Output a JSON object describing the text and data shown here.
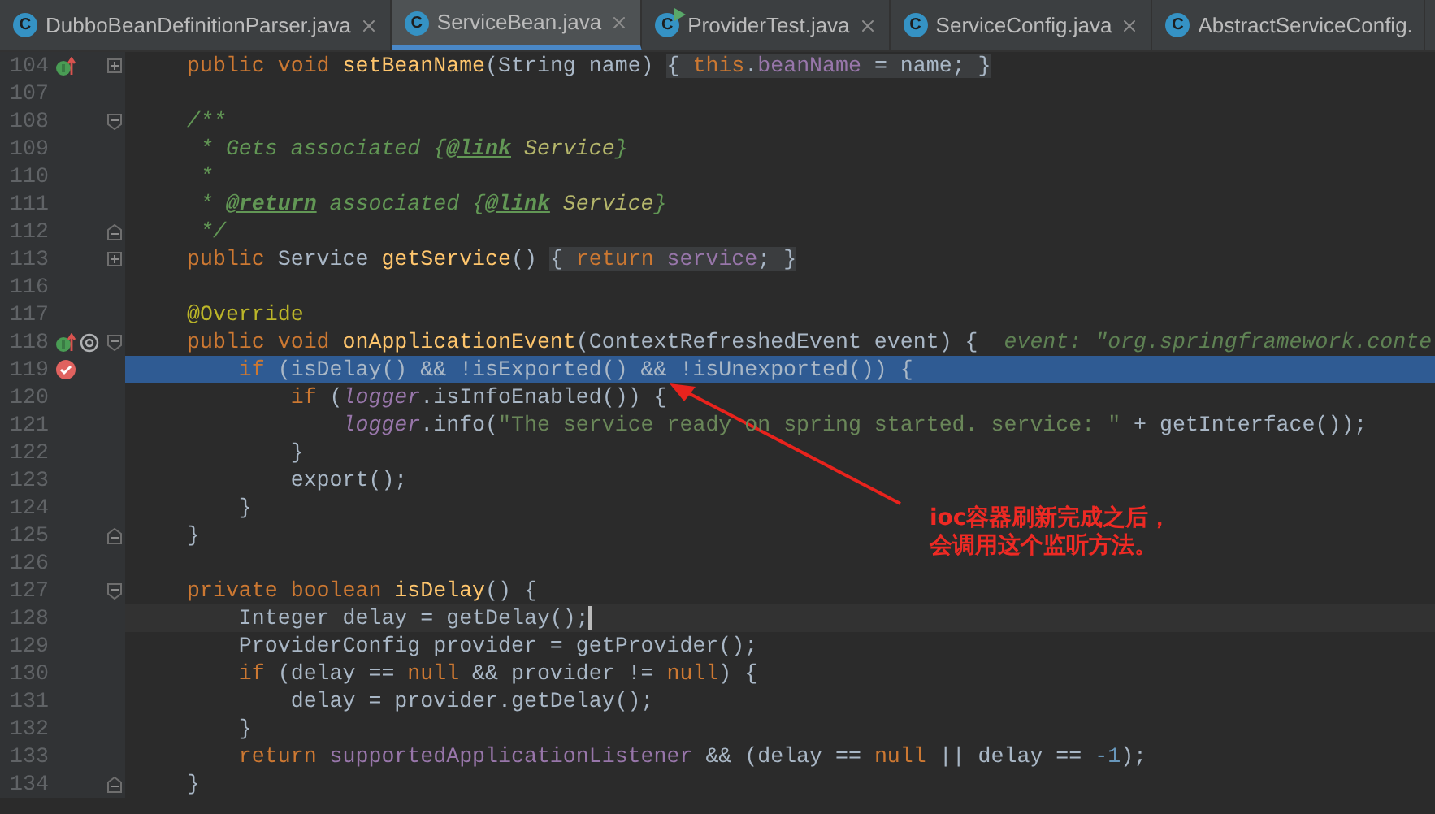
{
  "tabs": [
    {
      "label": "DubboBeanDefinitionParser.java",
      "icon_letter": "C",
      "runnable": false,
      "closable": true,
      "selected": false
    },
    {
      "label": "ServiceBean.java",
      "icon_letter": "C",
      "runnable": false,
      "closable": true,
      "selected": true
    },
    {
      "label": "ProviderTest.java",
      "icon_letter": "C",
      "runnable": true,
      "closable": true,
      "selected": false
    },
    {
      "label": "ServiceConfig.java",
      "icon_letter": "C",
      "runnable": false,
      "closable": true,
      "selected": false
    },
    {
      "label": "AbstractServiceConfig.",
      "icon_letter": "C",
      "runnable": false,
      "closable": false,
      "selected": false
    }
  ],
  "lines": [
    {
      "number": "104",
      "marks": [
        {
          "kind": "implements"
        }
      ],
      "fold_marker": {
        "kind": "expand"
      },
      "selected": false,
      "current": false,
      "tokens": [
        {
          "text": "public void ",
          "kind": "kw"
        },
        {
          "text": "setBeanName",
          "kind": "fn"
        },
        {
          "text": "(String name) ",
          "kind": "plain"
        },
        {
          "text": "{ ",
          "kind": "foldplain"
        },
        {
          "text": "this",
          "kind": "foldkw"
        },
        {
          "text": ".",
          "kind": "foldplain"
        },
        {
          "text": "beanName",
          "kind": "foldfield"
        },
        {
          "text": " = name; }",
          "kind": "foldplain"
        }
      ]
    },
    {
      "number": "107",
      "selected": false,
      "current": false
    },
    {
      "number": "108",
      "fold_marker": {
        "kind": "start"
      },
      "selected": false,
      "current": false,
      "tokens": [
        {
          "text": "/**",
          "kind": "doc"
        }
      ]
    },
    {
      "number": "109",
      "selected": false,
      "current": false,
      "tokens": [
        {
          "text": " * Gets associated {",
          "kind": "doc"
        },
        {
          "text": "@link",
          "kind": "doctag"
        },
        {
          "text": " Service",
          "kind": "docref"
        },
        {
          "text": "}",
          "kind": "doc"
        }
      ]
    },
    {
      "number": "110",
      "selected": false,
      "current": false,
      "tokens": [
        {
          "text": " *",
          "kind": "doc"
        }
      ]
    },
    {
      "number": "111",
      "selected": false,
      "current": false,
      "tokens": [
        {
          "text": " * ",
          "kind": "doc"
        },
        {
          "text": "@return",
          "kind": "doctag"
        },
        {
          "text": " associated {",
          "kind": "doc"
        },
        {
          "text": "@link",
          "kind": "doctag"
        },
        {
          "text": " Service",
          "kind": "docref"
        },
        {
          "text": "}",
          "kind": "doc"
        }
      ]
    },
    {
      "number": "112",
      "fold_marker": {
        "kind": "end"
      },
      "selected": false,
      "current": false,
      "tokens": [
        {
          "text": " */",
          "kind": "doc"
        }
      ]
    },
    {
      "number": "113",
      "fold_marker": {
        "kind": "expand"
      },
      "selected": false,
      "current": false,
      "tokens": [
        {
          "text": "public ",
          "kind": "kw"
        },
        {
          "text": "Service ",
          "kind": "plain"
        },
        {
          "text": "getService",
          "kind": "fn"
        },
        {
          "text": "() ",
          "kind": "plain"
        },
        {
          "text": "{ ",
          "kind": "foldplain"
        },
        {
          "text": "return ",
          "kind": "foldkw"
        },
        {
          "text": "service",
          "kind": "foldfield"
        },
        {
          "text": "; }",
          "kind": "foldplain"
        }
      ]
    },
    {
      "number": "116",
      "selected": false,
      "current": false
    },
    {
      "number": "117",
      "selected": false,
      "current": false,
      "tokens": [
        {
          "text": "@Override",
          "kind": "annotation"
        }
      ]
    },
    {
      "number": "118",
      "marks": [
        {
          "kind": "implements"
        },
        {
          "kind": "annotation"
        }
      ],
      "fold_marker": {
        "kind": "start"
      },
      "selected": false,
      "current": false,
      "tokens": [
        {
          "text": "public void ",
          "kind": "kw"
        },
        {
          "text": "onApplicationEvent",
          "kind": "fn"
        },
        {
          "text": "(ContextRefreshedEvent event) {  ",
          "kind": "plain"
        },
        {
          "text": "event: \"org.springframework.conte",
          "kind": "hint"
        }
      ]
    },
    {
      "number": "119",
      "marks": [
        {
          "kind": "breakpoint"
        }
      ],
      "selected": true,
      "current": false,
      "tokens": [
        {
          "text": "    if ",
          "kind": "kw"
        },
        {
          "text": "(isDelay() && !isExported() && !isUnexported()) {",
          "kind": "plain"
        }
      ]
    },
    {
      "number": "120",
      "selected": false,
      "current": false,
      "tokens": [
        {
          "text": "        if ",
          "kind": "kw"
        },
        {
          "text": "(",
          "kind": "plain"
        },
        {
          "text": "logger",
          "kind": "static"
        },
        {
          "text": ".isInfoEnabled()) {",
          "kind": "plain"
        }
      ]
    },
    {
      "number": "121",
      "selected": false,
      "current": false,
      "tokens": [
        {
          "text": "            logger",
          "kind": "static"
        },
        {
          "text": ".info(",
          "kind": "plain"
        },
        {
          "text": "\"The service ready on spring started. service: \"",
          "kind": "str"
        },
        {
          "text": " + getInterface());",
          "kind": "plain"
        }
      ]
    },
    {
      "number": "122",
      "selected": false,
      "current": false,
      "tokens": [
        {
          "text": "        }",
          "kind": "plain"
        }
      ]
    },
    {
      "number": "123",
      "selected": false,
      "current": false,
      "tokens": [
        {
          "text": "        export();",
          "kind": "plain"
        }
      ]
    },
    {
      "number": "124",
      "selected": false,
      "current": false,
      "tokens": [
        {
          "text": "    }",
          "kind": "plain"
        }
      ]
    },
    {
      "number": "125",
      "fold_marker": {
        "kind": "end"
      },
      "selected": false,
      "current": false,
      "tokens": [
        {
          "text": "}",
          "kind": "plain"
        }
      ]
    },
    {
      "number": "126",
      "selected": false,
      "current": false
    },
    {
      "number": "127",
      "fold_marker": {
        "kind": "start"
      },
      "selected": false,
      "current": false,
      "tokens": [
        {
          "text": "private boolean ",
          "kind": "kw"
        },
        {
          "text": "isDelay",
          "kind": "fn"
        },
        {
          "text": "() {",
          "kind": "plain"
        }
      ]
    },
    {
      "number": "128",
      "selected": false,
      "current": true,
      "tokens": [
        {
          "text": "    Integer delay = getDelay();",
          "kind": "plain"
        }
      ]
    },
    {
      "number": "129",
      "selected": false,
      "current": false,
      "tokens": [
        {
          "text": "    ProviderConfig provider = getProvider();",
          "kind": "plain"
        }
      ]
    },
    {
      "number": "130",
      "selected": false,
      "current": false,
      "tokens": [
        {
          "text": "    if ",
          "kind": "kw"
        },
        {
          "text": "(delay == ",
          "kind": "plain"
        },
        {
          "text": "null",
          "kind": "kw"
        },
        {
          "text": " && provider != ",
          "kind": "plain"
        },
        {
          "text": "null",
          "kind": "kw"
        },
        {
          "text": ") {",
          "kind": "plain"
        }
      ]
    },
    {
      "number": "131",
      "selected": false,
      "current": false,
      "tokens": [
        {
          "text": "        delay = provider.getDelay();",
          "kind": "plain"
        }
      ]
    },
    {
      "number": "132",
      "selected": false,
      "current": false,
      "tokens": [
        {
          "text": "    }",
          "kind": "plain"
        }
      ]
    },
    {
      "number": "133",
      "selected": false,
      "current": false,
      "tokens": [
        {
          "text": "    return ",
          "kind": "kw"
        },
        {
          "text": "supportedApplicationListener",
          "kind": "field"
        },
        {
          "text": " && (delay == ",
          "kind": "plain"
        },
        {
          "text": "null ",
          "kind": "kw"
        },
        {
          "text": "|| delay == ",
          "kind": "plain"
        },
        {
          "text": "-1",
          "kind": "num"
        },
        {
          "text": ");",
          "kind": "plain"
        }
      ]
    },
    {
      "number": "134",
      "fold_marker": {
        "kind": "end"
      },
      "selected": false,
      "current": false,
      "tokens": [
        {
          "text": "}",
          "kind": "plain"
        }
      ]
    }
  ],
  "callout": {
    "lines": [
      "ioc容器刷新完成之后，",
      "会调用这个监听方法。"
    ]
  }
}
